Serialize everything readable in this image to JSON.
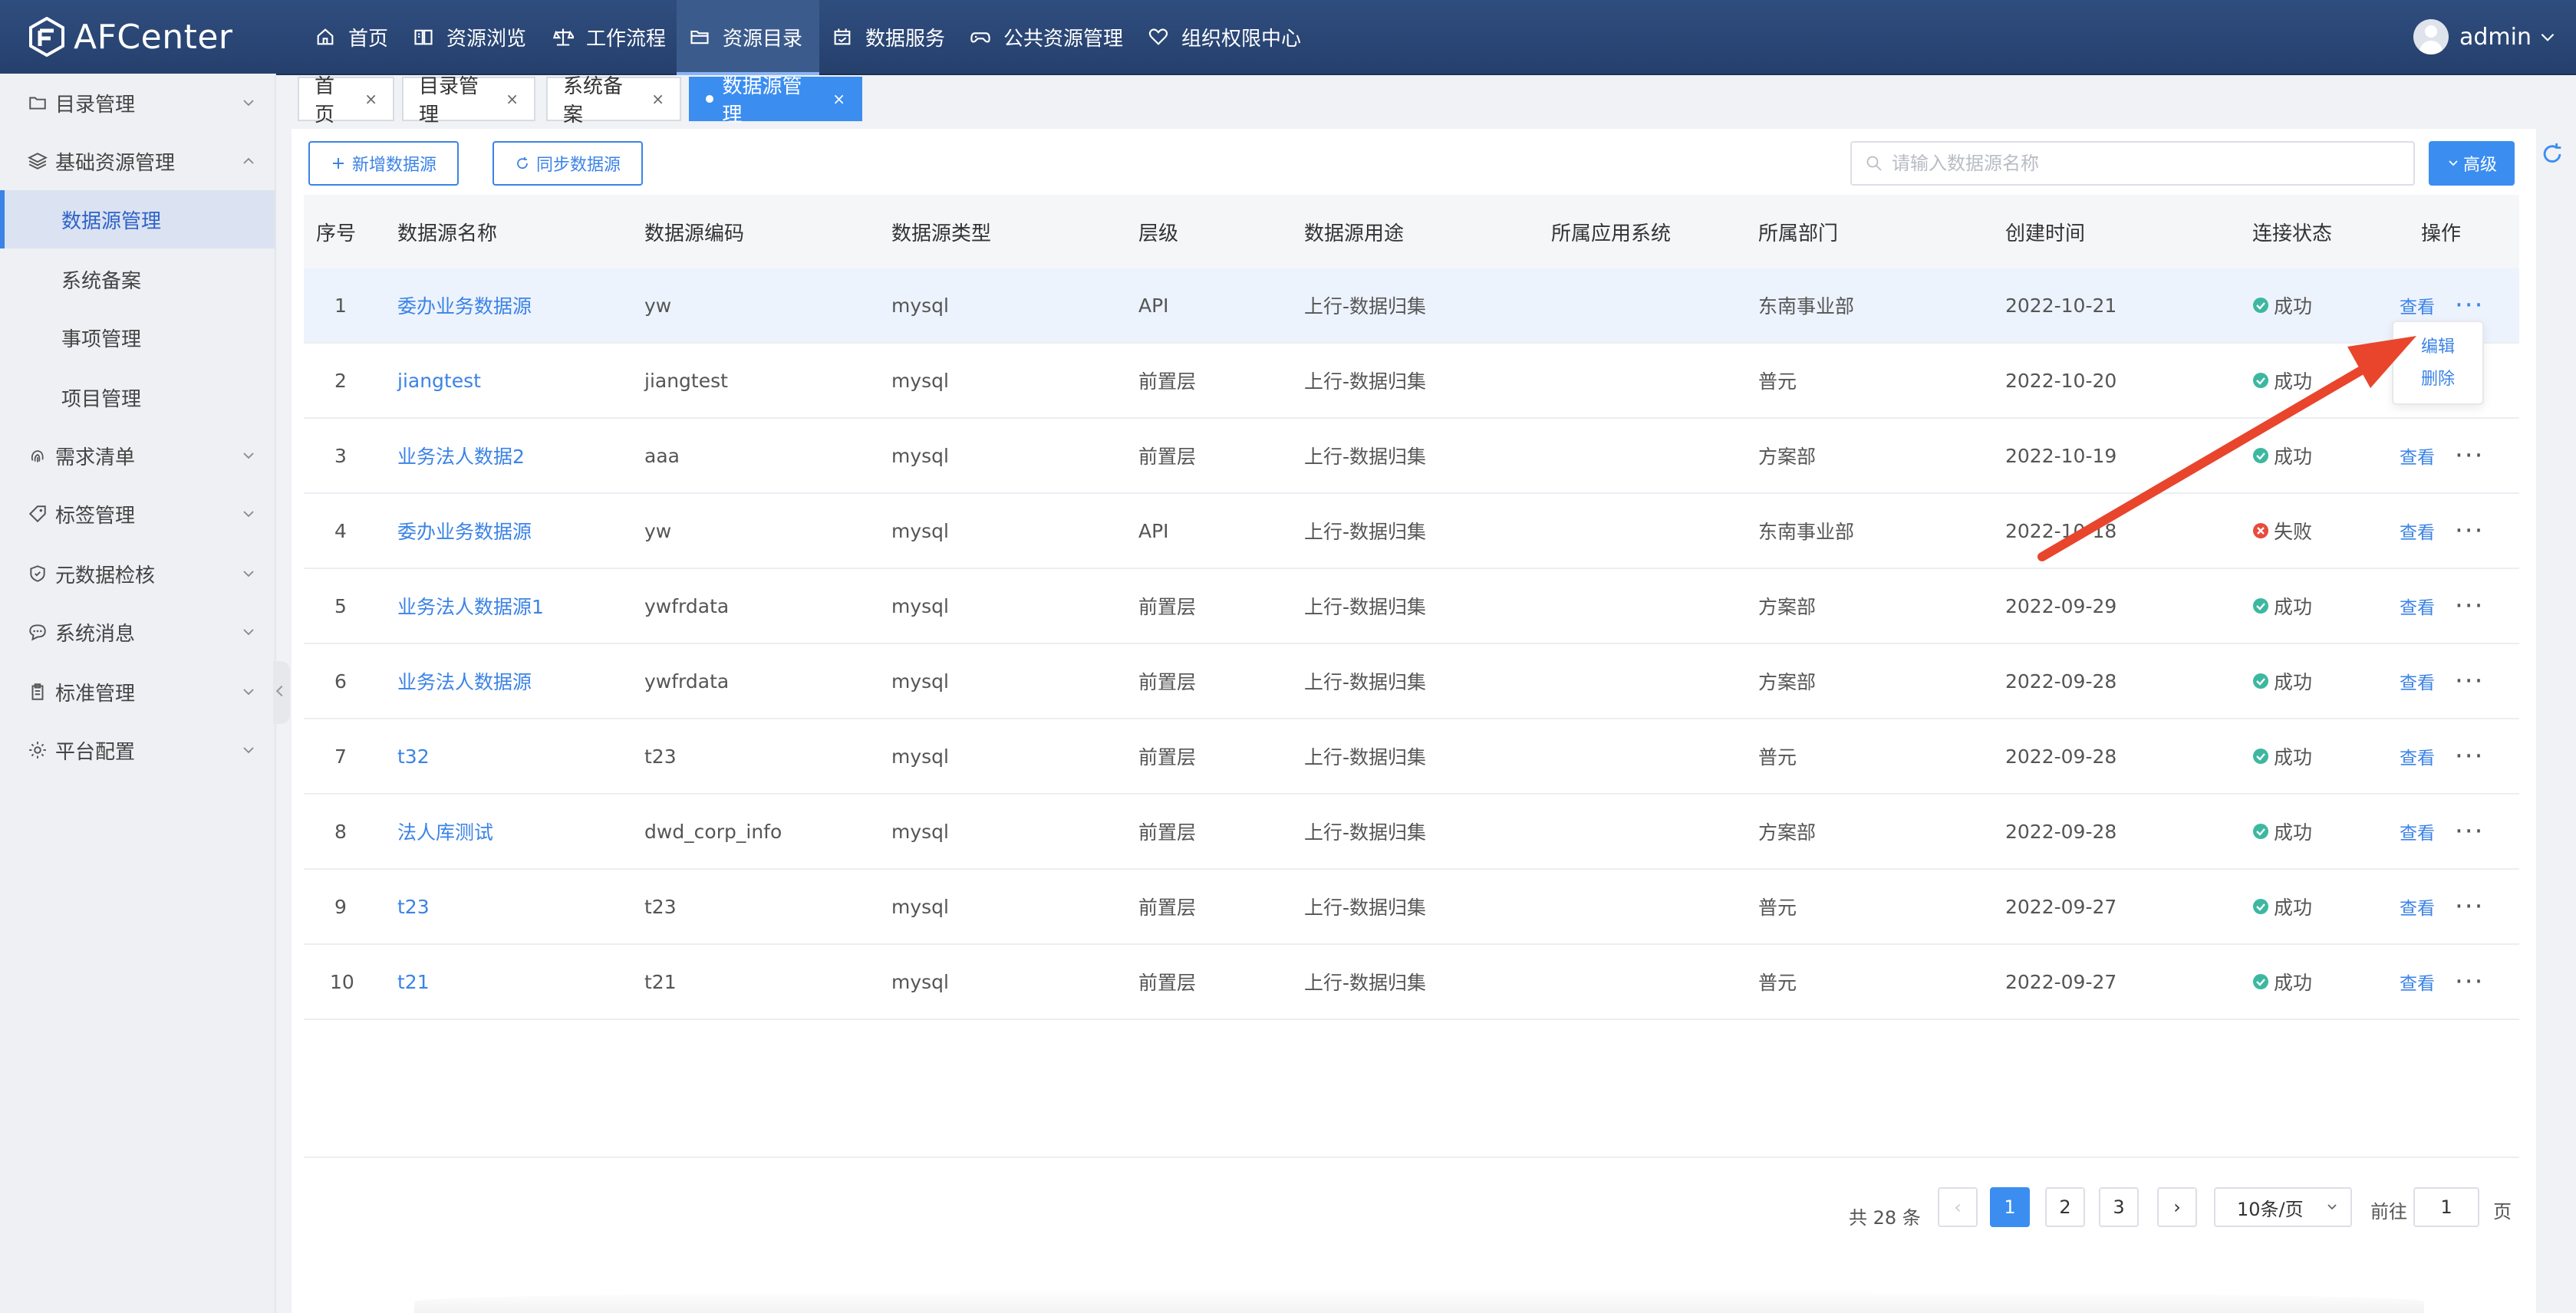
{
  "app": {
    "logo_text": "AFCenter"
  },
  "nav": {
    "items": [
      {
        "label": "首页",
        "icon": "home-icon"
      },
      {
        "label": "资源浏览",
        "icon": "book-icon"
      },
      {
        "label": "工作流程",
        "icon": "scale-icon"
      },
      {
        "label": "资源目录",
        "icon": "folder-icon",
        "active": true
      },
      {
        "label": "数据服务",
        "icon": "calendar-check-icon"
      },
      {
        "label": "公共资源管理",
        "icon": "gamepad-icon"
      },
      {
        "label": "组织权限中心",
        "icon": "heart-icon"
      }
    ],
    "user": "admin"
  },
  "sidebar": {
    "menu": [
      {
        "label": "目录管理",
        "icon": "folder-icon",
        "expanded": false
      },
      {
        "label": "基础资源管理",
        "icon": "layers-icon",
        "expanded": true
      },
      {
        "label": "需求清单",
        "icon": "fingerprint-icon",
        "expanded": false
      },
      {
        "label": "标签管理",
        "icon": "tag-icon",
        "expanded": false
      },
      {
        "label": "元数据检核",
        "icon": "shield-icon",
        "expanded": false
      },
      {
        "label": "系统消息",
        "icon": "chat-icon",
        "expanded": false
      },
      {
        "label": "标准管理",
        "icon": "clipboard-icon",
        "expanded": false
      },
      {
        "label": "平台配置",
        "icon": "gear-icon",
        "expanded": false
      }
    ],
    "submenu": [
      {
        "label": "数据源管理",
        "active": true
      },
      {
        "label": "系统备案"
      },
      {
        "label": "事项管理"
      },
      {
        "label": "项目管理"
      }
    ]
  },
  "tabs": [
    {
      "label": "首页"
    },
    {
      "label": "目录管理"
    },
    {
      "label": "系统备案"
    },
    {
      "label": "数据源管理",
      "active": true
    }
  ],
  "toolbar": {
    "add_label": "新增数据源",
    "sync_label": "同步数据源",
    "search_placeholder": "请输入数据源名称",
    "search_value": "",
    "advanced_label": "高级"
  },
  "table": {
    "columns": [
      "序号",
      "数据源名称",
      "数据源编码",
      "数据源类型",
      "层级",
      "数据源用途",
      "所属应用系统",
      "所属部门",
      "创建时间",
      "连接状态",
      "操作"
    ],
    "rows": [
      {
        "idx": "1",
        "name": "委办业务数据源",
        "code": "yw",
        "type": "mysql",
        "level": "API",
        "usage": "上行-数据归集",
        "app": "",
        "dept": "东南事业部",
        "created": "2022-10-21",
        "status": "成功",
        "ok": true
      },
      {
        "idx": "2",
        "name": "jiangtest",
        "code": "jiangtest",
        "type": "mysql",
        "level": "前置层",
        "usage": "上行-数据归集",
        "app": "",
        "dept": "普元",
        "created": "2022-10-20",
        "status": "成功",
        "ok": true
      },
      {
        "idx": "3",
        "name": "业务法人数据2",
        "code": "aaa",
        "type": "mysql",
        "level": "前置层",
        "usage": "上行-数据归集",
        "app": "",
        "dept": "方案部",
        "created": "2022-10-19",
        "status": "成功",
        "ok": true
      },
      {
        "idx": "4",
        "name": "委办业务数据源",
        "code": "yw",
        "type": "mysql",
        "level": "API",
        "usage": "上行-数据归集",
        "app": "",
        "dept": "东南事业部",
        "created": "2022-10-18",
        "status": "失败",
        "ok": false
      },
      {
        "idx": "5",
        "name": "业务法人数据源1",
        "code": "ywfrdata",
        "type": "mysql",
        "level": "前置层",
        "usage": "上行-数据归集",
        "app": "",
        "dept": "方案部",
        "created": "2022-09-29",
        "status": "成功",
        "ok": true
      },
      {
        "idx": "6",
        "name": "业务法人数据源",
        "code": "ywfrdata",
        "type": "mysql",
        "level": "前置层",
        "usage": "上行-数据归集",
        "app": "",
        "dept": "方案部",
        "created": "2022-09-28",
        "status": "成功",
        "ok": true
      },
      {
        "idx": "7",
        "name": "t32",
        "code": "t23",
        "type": "mysql",
        "level": "前置层",
        "usage": "上行-数据归集",
        "app": "",
        "dept": "普元",
        "created": "2022-09-28",
        "status": "成功",
        "ok": true
      },
      {
        "idx": "8",
        "name": "法人库测试",
        "code": "dwd_corp_info",
        "type": "mysql",
        "level": "前置层",
        "usage": "上行-数据归集",
        "app": "",
        "dept": "方案部",
        "created": "2022-09-28",
        "status": "成功",
        "ok": true
      },
      {
        "idx": "9",
        "name": "t23",
        "code": "t23",
        "type": "mysql",
        "level": "前置层",
        "usage": "上行-数据归集",
        "app": "",
        "dept": "普元",
        "created": "2022-09-27",
        "status": "成功",
        "ok": true
      },
      {
        "idx": "10",
        "name": "t21",
        "code": "t21",
        "type": "mysql",
        "level": "前置层",
        "usage": "上行-数据归集",
        "app": "",
        "dept": "普元",
        "created": "2022-09-27",
        "status": "成功",
        "ok": true
      }
    ],
    "view_label": "查看",
    "more_label": "···"
  },
  "dropdown": {
    "edit_label": "编辑",
    "delete_label": "删除"
  },
  "pagination": {
    "total_text": "共 28 条",
    "pages": [
      "1",
      "2",
      "3"
    ],
    "current": "1",
    "page_size": "10条/页",
    "goto_label": "前往",
    "goto_value": "1",
    "page_suffix": "页"
  },
  "colors": {
    "primary": "#3b8df0",
    "topbar": "#2f4d7e",
    "success": "#3db8a0",
    "error": "#e74c3c",
    "arrow": "#e8452c"
  }
}
